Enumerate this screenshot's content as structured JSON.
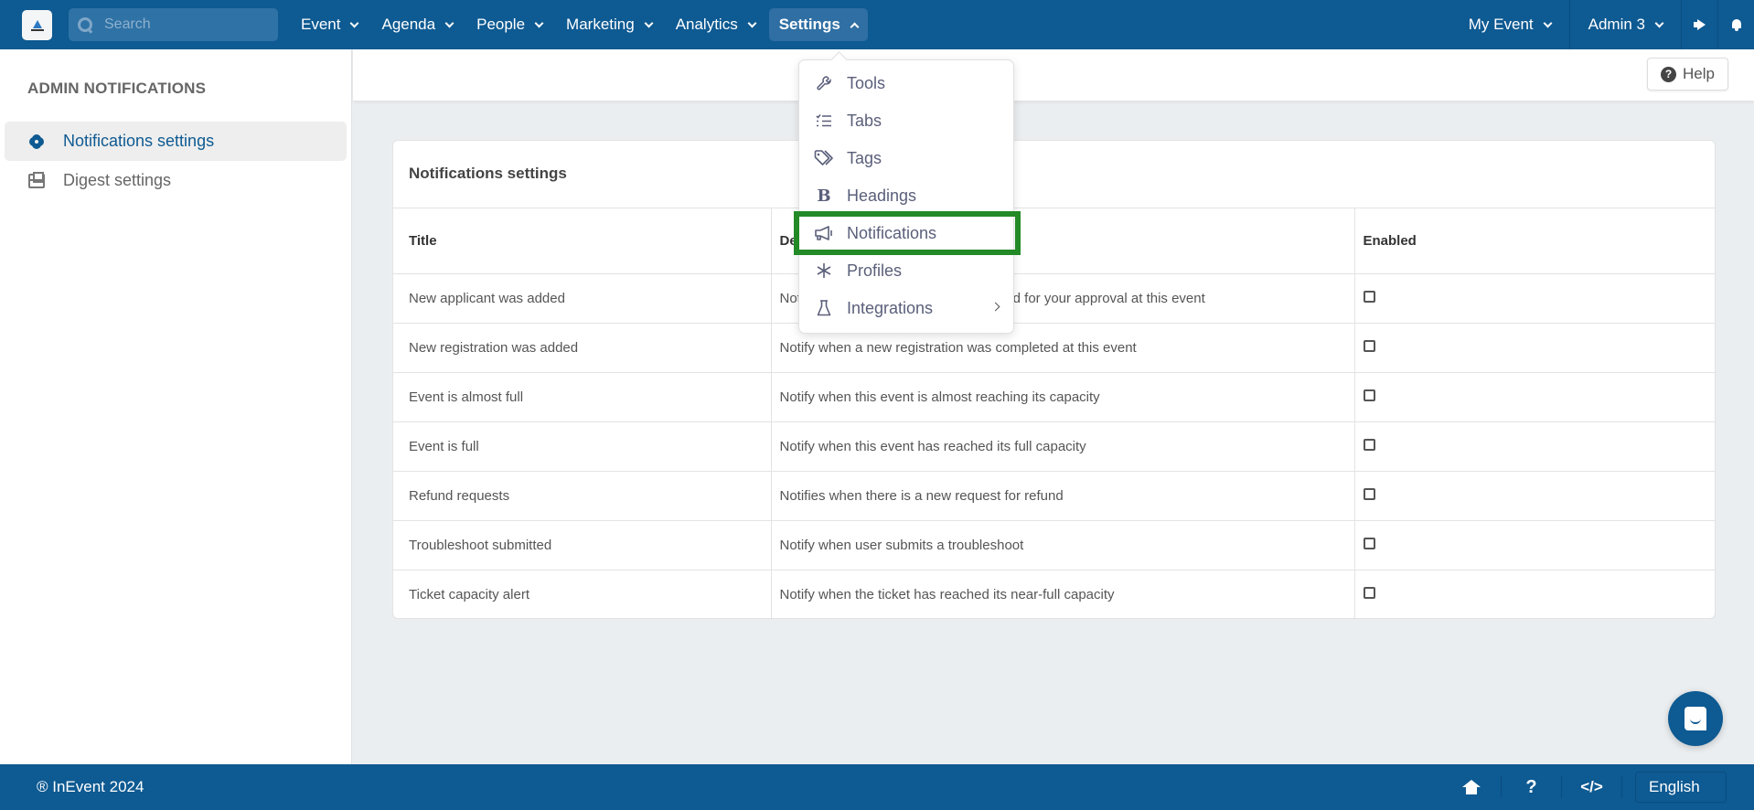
{
  "topbar": {
    "search_placeholder": "Search",
    "nav": [
      {
        "label": "Event",
        "active": false
      },
      {
        "label": "Agenda",
        "active": false
      },
      {
        "label": "People",
        "active": false
      },
      {
        "label": "Marketing",
        "active": false
      },
      {
        "label": "Analytics",
        "active": false
      },
      {
        "label": "Settings",
        "active": true
      }
    ],
    "my_event": "My Event",
    "admin": "Admin 3",
    "icons": [
      "megaphone-icon",
      "bell-icon"
    ]
  },
  "sidebar": {
    "title": "ADMIN NOTIFICATIONS",
    "items": [
      {
        "label": "Notifications settings",
        "icon": "gear-icon",
        "active": true
      },
      {
        "label": "Digest settings",
        "icon": "envelope-icon",
        "active": false
      }
    ]
  },
  "help": {
    "label": "Help"
  },
  "card": {
    "title": "Notifications settings",
    "columns": [
      "Title",
      "Description",
      "Enabled"
    ],
    "rows": [
      {
        "title": "New applicant was added",
        "description": "Notify when a new applicant was added for your approval at this event",
        "enabled": false
      },
      {
        "title": "New registration was added",
        "description": "Notify when a new registration was completed at this event",
        "enabled": false
      },
      {
        "title": "Event is almost full",
        "description": "Notify when this event is almost reaching its capacity",
        "enabled": false
      },
      {
        "title": "Event is full",
        "description": "Notify when this event has reached its full capacity",
        "enabled": false
      },
      {
        "title": "Refund requests",
        "description": "Notifies when there is a new request for refund",
        "enabled": false
      },
      {
        "title": "Troubleshoot submitted",
        "description": "Notify when user submits a troubleshoot",
        "enabled": false
      },
      {
        "title": "Ticket capacity alert",
        "description": "Notify when the ticket has reached its near-full capacity",
        "enabled": false
      }
    ]
  },
  "settings_menu": {
    "items": [
      {
        "label": "Tools",
        "icon": "wrench-icon"
      },
      {
        "label": "Tabs",
        "icon": "list-check-icon"
      },
      {
        "label": "Tags",
        "icon": "tags-icon"
      },
      {
        "label": "Headings",
        "icon": "bold-icon"
      },
      {
        "label": "Notifications",
        "icon": "megaphone-icon",
        "highlighted": true
      },
      {
        "label": "Profiles",
        "icon": "asterisk-icon"
      },
      {
        "label": "Integrations",
        "icon": "flask-icon",
        "has_submenu": true
      }
    ]
  },
  "footer": {
    "copyright": "® InEvent 2024",
    "icons": [
      "home-icon",
      "question-icon",
      "code-icon"
    ],
    "language": "English"
  },
  "colors": {
    "brand": "#0e5a92",
    "highlight": "#238a27"
  }
}
